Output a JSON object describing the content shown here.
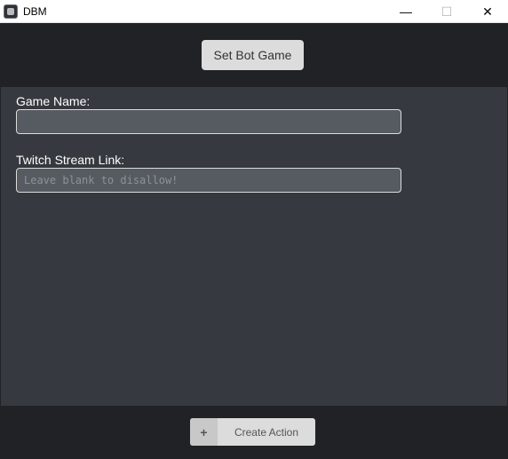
{
  "window": {
    "title": "DBM",
    "minimize_glyph": "—",
    "maximize_glyph": "☐",
    "close_glyph": "✕"
  },
  "header": {
    "set_bot_game_label": "Set Bot Game"
  },
  "form": {
    "game_name": {
      "label": "Game Name:",
      "value": "",
      "placeholder": ""
    },
    "twitch_link": {
      "label": "Twitch Stream Link:",
      "value": "",
      "placeholder": "Leave blank to disallow!"
    }
  },
  "footer": {
    "create_action_icon": "+",
    "create_action_label": "Create Action"
  }
}
